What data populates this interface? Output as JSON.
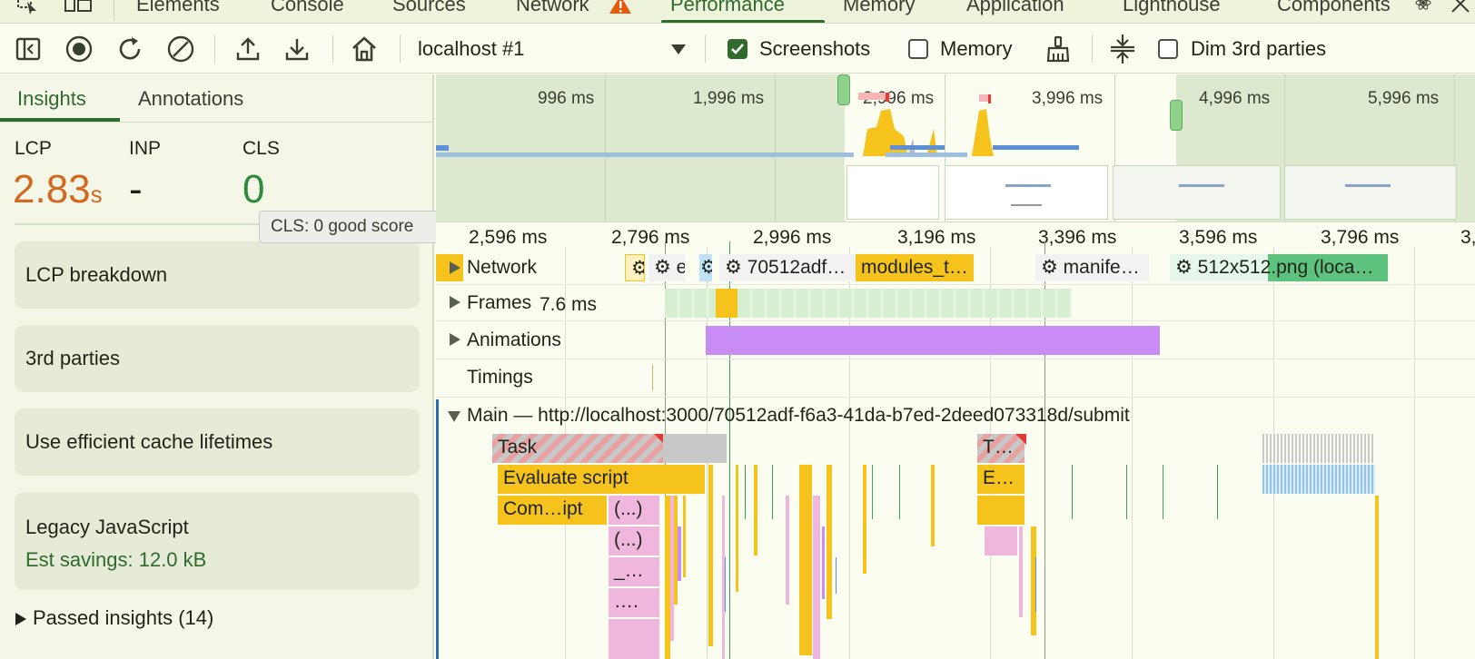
{
  "devtools_tabs": [
    "Elements",
    "Console",
    "Sources",
    "Network",
    "Performance",
    "Memory",
    "Application",
    "Lighthouse",
    "Components"
  ],
  "toolbar": {
    "target": "localhost #1",
    "screenshots_label": "Screenshots",
    "memory_label": "Memory",
    "dim_label": "Dim 3rd parties",
    "screenshots_checked": true,
    "memory_checked": false,
    "dim_checked": false
  },
  "sidebar": {
    "tabs": [
      "Insights",
      "Annotations"
    ],
    "metrics": [
      {
        "label": "LCP",
        "value": "2.83",
        "unit": "s",
        "color": "#d2691e"
      },
      {
        "label": "INP",
        "value": "-",
        "unit": "",
        "color": "#1f2418"
      },
      {
        "label": "CLS",
        "value": "0",
        "unit": "",
        "color": "#2e8b3a"
      }
    ],
    "tooltip": "CLS: 0 good score",
    "cards": [
      "LCP breakdown",
      "3rd parties",
      "Use efficient cache lifetimes",
      "Legacy JavaScript"
    ],
    "legacy_savings": "Est savings: 12.0 kB",
    "passed": "Passed insights (14)"
  },
  "overview": {
    "ticks": [
      "996 ms",
      "1,996 ms",
      "2,996 ms",
      "3,996 ms",
      "4,996 ms",
      "5,996 ms"
    ]
  },
  "ruler": [
    "2,596 ms",
    "2,796 ms",
    "2,996 ms",
    "3,196 ms",
    "3,396 ms",
    "3,596 ms",
    "3,796 ms",
    "3,"
  ],
  "tracks": {
    "network": "Network",
    "frames": "Frames",
    "frames_time": "7.6 ms",
    "animations": "Animations",
    "timings": "Timings",
    "main": "Main — http://localhost:3000/70512adf-f6a3-41da-b7ed-2deed073318d/submit"
  },
  "network_items": [
    "e",
    "70512adf…",
    "modules_t…",
    "manife…",
    "512x512.png (loca…"
  ],
  "flame": {
    "task": "Task",
    "task2": "T…",
    "evaluate": "Evaluate script",
    "evaluate2": "E…",
    "compile": "Com…ipt",
    "anon1": "(...)",
    "anon2": "(...)",
    "anon3": "_…",
    "anon4": "…."
  },
  "colors": {
    "accent": "#2e6b2c",
    "task": "#c8c8c8",
    "script": "#f6c21c",
    "anim": "#c98cf5",
    "net_green": "#5ec27f",
    "net_blue": "#5b8fd6",
    "pink": "#f0b7de",
    "long_task": "#e8a0a0"
  },
  "icons": [
    "inspect-icon",
    "device-icon",
    "warning-icon",
    "react-icon",
    "close-icon",
    "sidebar-toggle-icon",
    "record-icon",
    "reload-icon",
    "clear-icon",
    "upload-icon",
    "download-icon",
    "home-icon",
    "chevron-down-icon",
    "broom-icon",
    "collapse-icon"
  ]
}
